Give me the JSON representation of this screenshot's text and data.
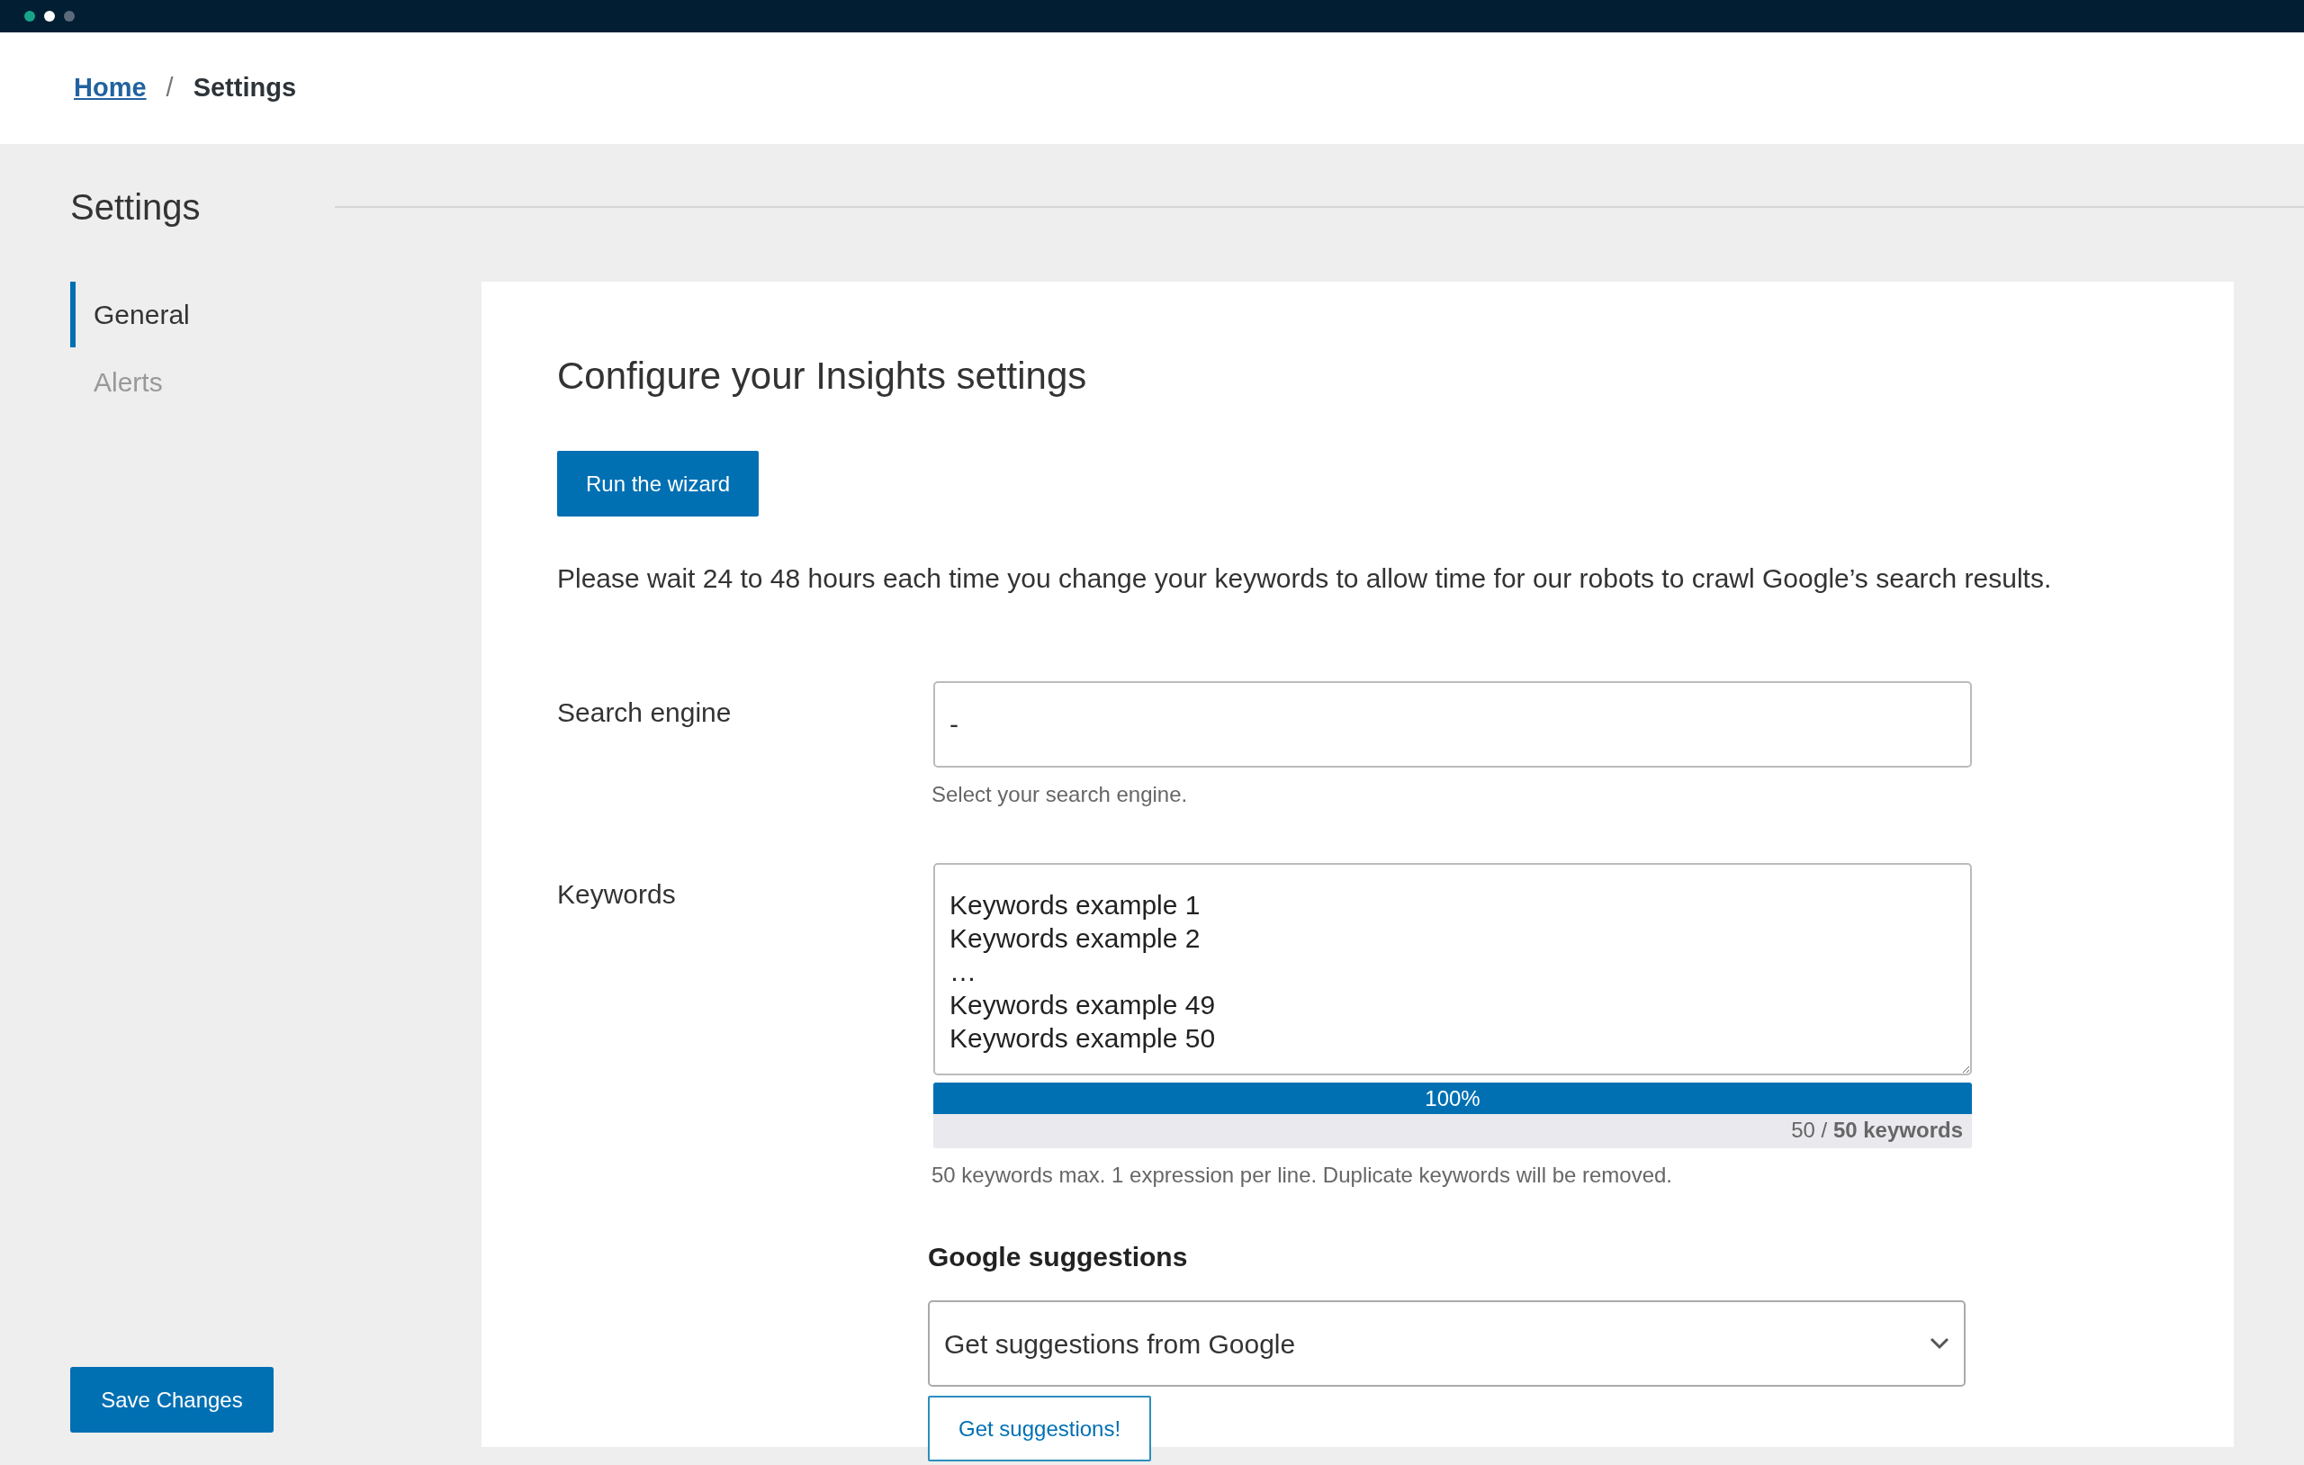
{
  "breadcrumb": [
    {
      "label": "Home",
      "kind": "link"
    },
    {
      "label": "/",
      "kind": "separator"
    },
    {
      "label": "Settings",
      "kind": "current"
    }
  ],
  "page_title": "Settings",
  "sidebar": {
    "items": [
      {
        "label": "General",
        "selected": true
      },
      {
        "label": "Alerts",
        "selected": false
      }
    ],
    "save_button": "Save Changes"
  },
  "panel": {
    "title": "Configure your Insights settings",
    "wizard_button": "Run the wizard",
    "notice": "Please wait 24 to 48 hours each time you change your keywords to allow time for our robots to crawl Google’s search results.",
    "search_engine": {
      "label": "Search engine",
      "value": "-",
      "help": "Select your search engine."
    },
    "keywords": {
      "label": "Keywords",
      "lines": [
        "Keywords example 1",
        "Keywords example 2",
        "…",
        "Keywords example 49",
        "Keywords example 50"
      ],
      "progress": {
        "level": 1.0,
        "label": "100%"
      },
      "counter": "50 / **50 keywords**",
      "help": "50 keywords max. 1 expression per line. Duplicate keywords will be removed."
    },
    "google_suggestions": {
      "title": "Google suggestions",
      "select_value": "Get suggestions from Google",
      "button": "Get suggestions!"
    }
  }
}
